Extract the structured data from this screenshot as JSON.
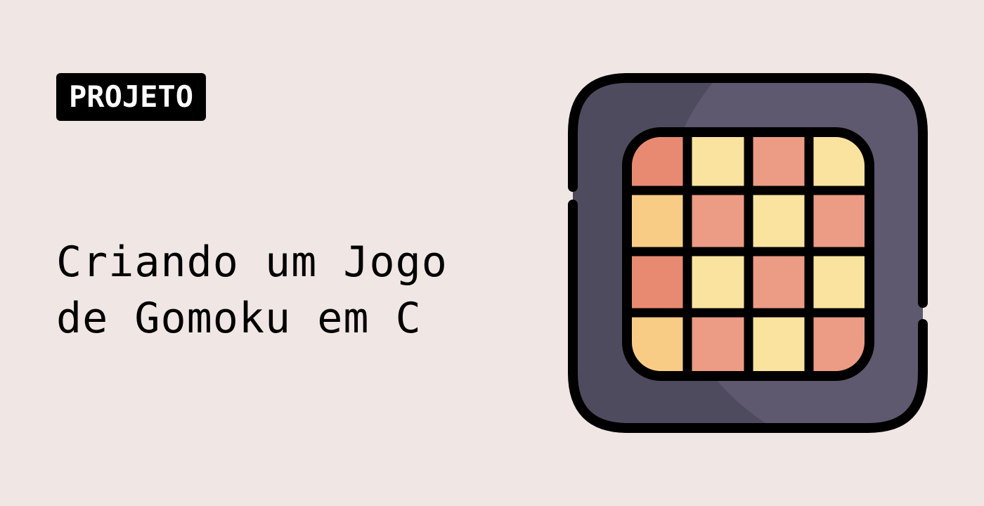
{
  "badge": {
    "label": "PROJETO"
  },
  "title": {
    "line1": "Criando um Jogo",
    "line2": "de Gomoku em C"
  },
  "icon": {
    "name": "game-board-icon",
    "grid": [
      [
        "salmon-dark",
        "yellow",
        "salmon",
        "yellow"
      ],
      [
        "orange-light",
        "salmon",
        "yellow",
        "salmon"
      ],
      [
        "salmon-dark",
        "yellow",
        "salmon",
        "yellow"
      ],
      [
        "orange-light",
        "salmon",
        "yellow",
        "salmon"
      ]
    ]
  },
  "colors": {
    "background": "#f0e6e4",
    "badge_bg": "#000000",
    "badge_text": "#ffffff",
    "frame_dark": "#4f4b5f",
    "frame_light": "#5e596f",
    "outline": "#000000",
    "salmon": "#ec9b84",
    "salmon_dark": "#e88a72",
    "yellow": "#fae39f",
    "orange_light": "#f9cc86"
  }
}
